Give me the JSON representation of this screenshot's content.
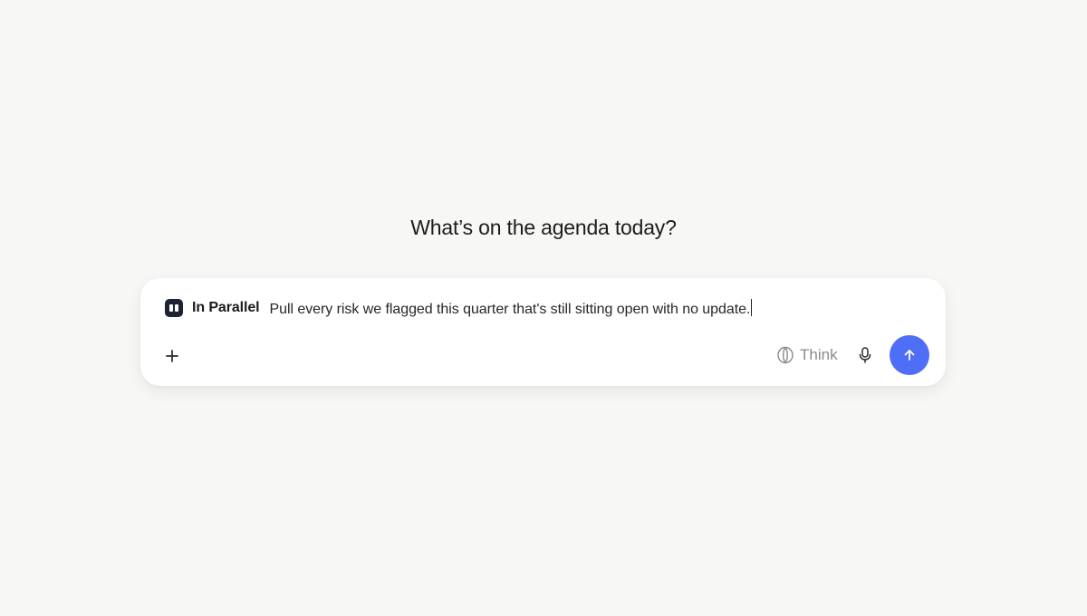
{
  "heading": "What’s on the agenda today?",
  "composer": {
    "mode": {
      "label": "In Parallel",
      "icon": "parallel-mode-icon"
    },
    "input_value": "Pull every risk we flagged this quarter that's still sitting open with no update.",
    "add_icon": "plus-icon",
    "think": {
      "label": "Think",
      "icon": "brain-icon"
    },
    "mic_icon": "microphone-icon",
    "send_icon": "arrow-up-icon"
  },
  "colors": {
    "background": "#f7f7f5",
    "send_button": "#4f6ef7",
    "mode_icon": "#1c2433",
    "think_label": "#8a8a8a"
  }
}
